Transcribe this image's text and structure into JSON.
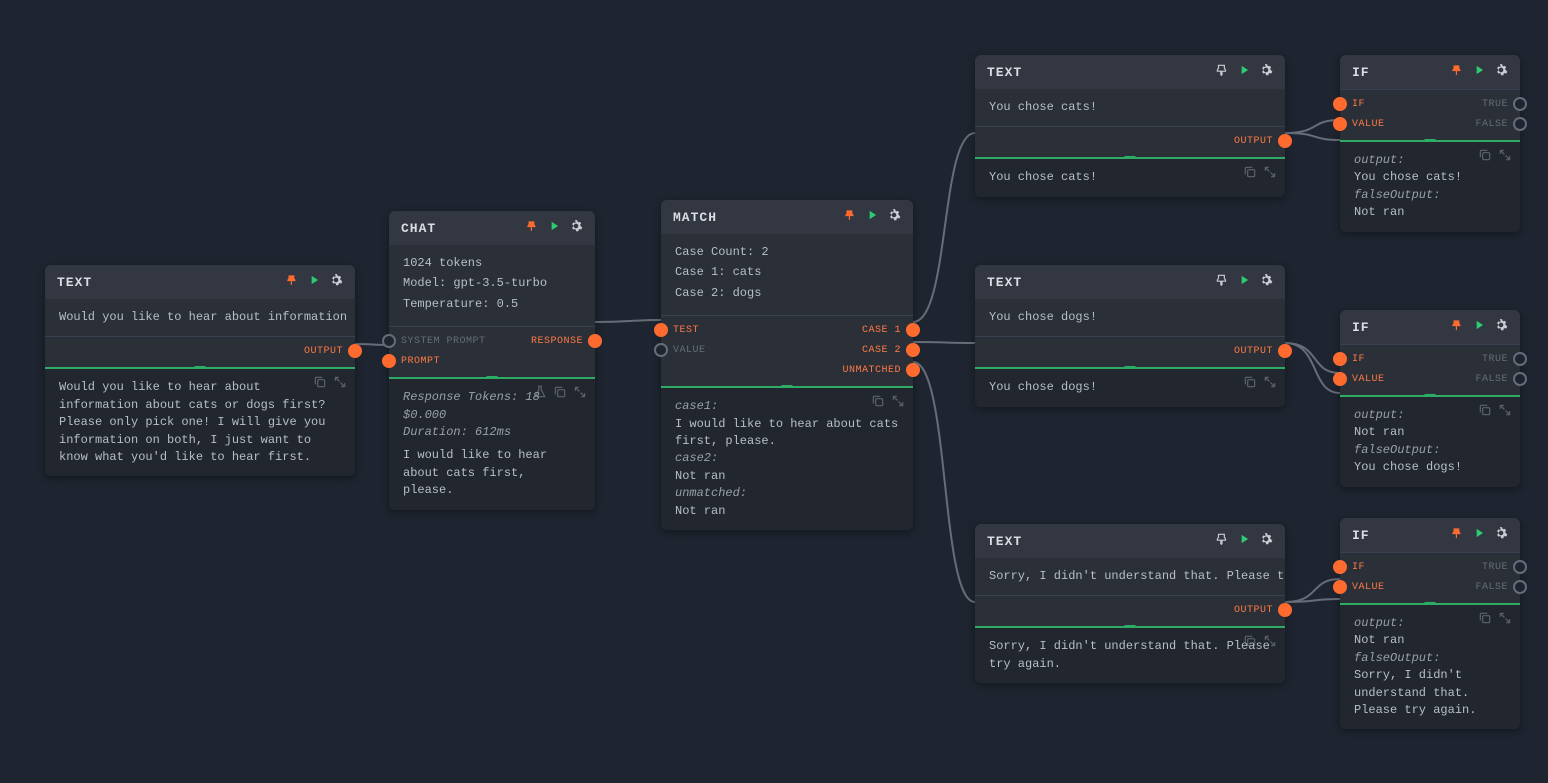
{
  "nodes": {
    "text1": {
      "title": "TEXT",
      "input": "Would you like to hear about information a",
      "output_port": "OUTPUT",
      "output_text": "Would you like to hear about information about cats or dogs first? Please only pick one! I will give you information on both, I just want to know what you'd like to hear first."
    },
    "chat": {
      "title": "CHAT",
      "params": {
        "tokens": "1024 tokens",
        "model": "Model: gpt-3.5-turbo",
        "temperature": "Temperature: 0.5"
      },
      "in_ports": {
        "system_prompt": "SYSTEM PROMPT",
        "prompt": "PROMPT"
      },
      "out_ports": {
        "response": "RESPONSE"
      },
      "output_meta": {
        "response_tokens": "Response Tokens: 18",
        "cost": "$0.000",
        "duration": "Duration: 612ms"
      },
      "output_text": "I would like to hear about cats first, please."
    },
    "match": {
      "title": "MATCH",
      "params": {
        "case_count": "Case Count: 2",
        "case1": "Case 1: cats",
        "case2": "Case 2: dogs"
      },
      "in_ports": {
        "test": "TEST",
        "value": "VALUE"
      },
      "out_ports": {
        "case1": "CASE 1",
        "case2": "CASE 2",
        "unmatched": "UNMATCHED"
      },
      "output": {
        "case1_label": "case1:",
        "case1_text": "I would like to hear about cats first, please.",
        "case2_label": "case2:",
        "case2_text": "Not ran",
        "unmatched_label": "unmatched:",
        "unmatched_text": "Not ran"
      }
    },
    "text_cats": {
      "title": "TEXT",
      "input": "You chose cats!",
      "output_port": "OUTPUT",
      "output_text": "You chose cats!"
    },
    "text_dogs": {
      "title": "TEXT",
      "input": "You chose dogs!",
      "output_port": "OUTPUT",
      "output_text": "You chose dogs!"
    },
    "text_sorry": {
      "title": "TEXT",
      "input": "Sorry, I didn't understand that. Please tr",
      "output_port": "OUTPUT",
      "output_text": "Sorry, I didn't understand that. Please try again."
    },
    "if_cats": {
      "title": "IF",
      "in_ports": {
        "if": "IF",
        "value": "VALUE"
      },
      "out_ports": {
        "true": "TRUE",
        "false": "FALSE"
      },
      "output": {
        "output_label": "output:",
        "output_text": "You chose cats!",
        "false_label": "falseOutput:",
        "false_text": "Not ran"
      }
    },
    "if_dogs": {
      "title": "IF",
      "in_ports": {
        "if": "IF",
        "value": "VALUE"
      },
      "out_ports": {
        "true": "TRUE",
        "false": "FALSE"
      },
      "output": {
        "output_label": "output:",
        "output_text": "Not ran",
        "false_label": "falseOutput:",
        "false_text": "You chose dogs!"
      }
    },
    "if_sorry": {
      "title": "IF",
      "in_ports": {
        "if": "IF",
        "value": "VALUE"
      },
      "out_ports": {
        "true": "TRUE",
        "false": "FALSE"
      },
      "output": {
        "output_label": "output:",
        "output_text": "Not ran",
        "false_label": "falseOutput:",
        "false_text": "Sorry, I didn't understand that. Please try again."
      }
    }
  }
}
